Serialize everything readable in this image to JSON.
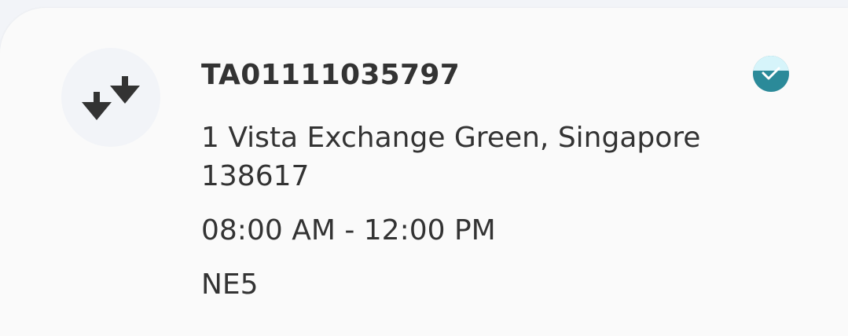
{
  "card": {
    "tracking_id": "TA01111035797",
    "address": "1 Vista Exchange Green, Singapore 138617",
    "time_window": "08:00 AM - 12:00 PM",
    "zone": "NE5",
    "type_icon": "double-down-arrows-icon",
    "status_icon": "check-circle-icon"
  },
  "colors": {
    "card_background": "#fafafa",
    "page_background": "#f2f4f8",
    "text": "#333333",
    "status_teal": "#2b8a99",
    "status_light": "#d6f4fa"
  }
}
